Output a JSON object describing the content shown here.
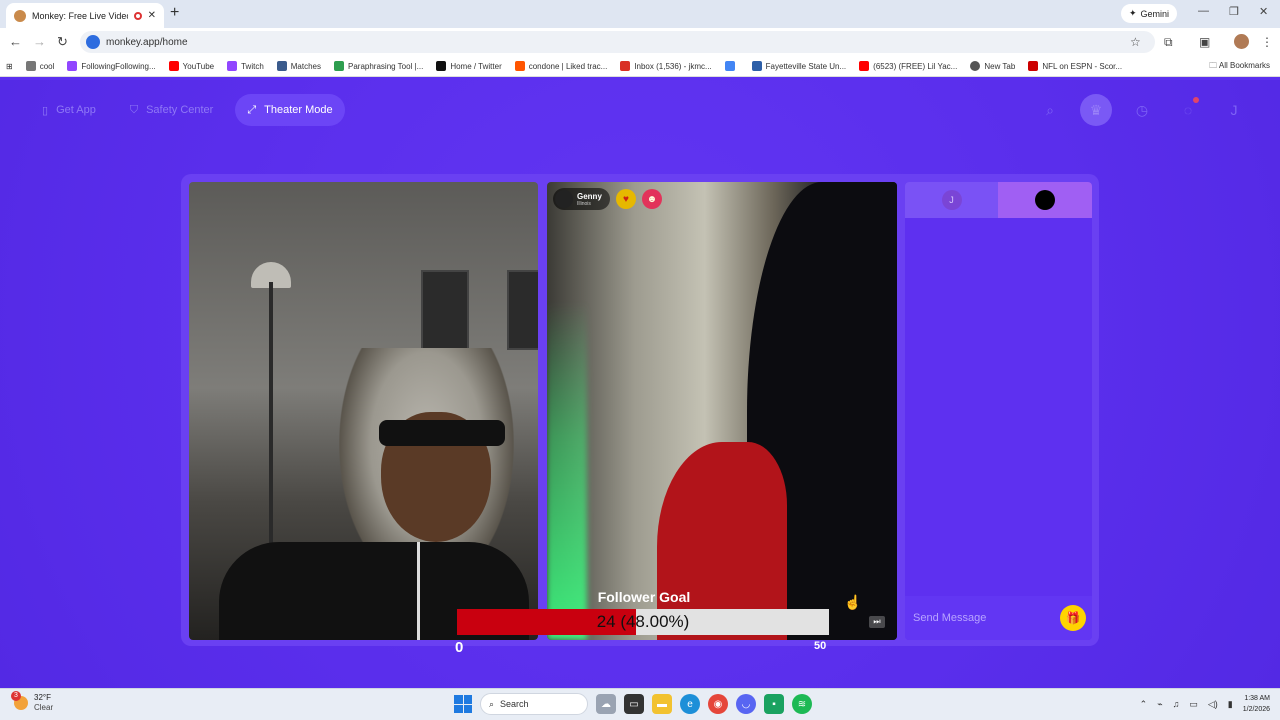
{
  "browser": {
    "tab_title": "Monkey: Free Live Video C",
    "new_tab": "+",
    "close": "✕",
    "gemini_label": "Gemini",
    "url": "monkey.app/home",
    "bookmarks": [
      {
        "label": "cool",
        "color": "#777777"
      },
      {
        "label": "FollowingFollowing...",
        "color": "#9146ff"
      },
      {
        "label": "YouTube",
        "color": "#ff0000"
      },
      {
        "label": "Twitch",
        "color": "#9146ff"
      },
      {
        "label": "Matches",
        "color": "#3b5b8c"
      },
      {
        "label": "Paraphrasing Tool |...",
        "color": "#2e9e4f"
      },
      {
        "label": "Home / Twitter",
        "color": "#111111"
      },
      {
        "label": "condone | Liked trac...",
        "color": "#ff5500"
      },
      {
        "label": "Inbox (1,536) - jkmc...",
        "color": "#d93025"
      },
      {
        "label": "",
        "color": "#4285f4"
      },
      {
        "label": "Fayetteville State Un...",
        "color": "#2d5fa8"
      },
      {
        "label": "(6523) (FREE) Lil Yac...",
        "color": "#ff0000"
      },
      {
        "label": "New Tab",
        "color": "#555555"
      },
      {
        "label": "NFL on ESPN - Scor...",
        "color": "#cc0000"
      }
    ],
    "all_bookmarks": "All Bookmarks"
  },
  "nav": {
    "get_app": "Get App",
    "safety_center": "Safety Center",
    "theater_mode": "Theater Mode"
  },
  "right_nav_icons": [
    "search-icon",
    "crown-icon",
    "history-icon",
    "chat-icon",
    "profile-icon"
  ],
  "profile_initial": "J",
  "remote_user": {
    "name": "Genny",
    "location": "Illinois"
  },
  "chat": {
    "self_initial": "J",
    "placeholder": "Send Message"
  },
  "follower_goal": {
    "title": "Follower Goal",
    "current": 24,
    "text": "24 (48.00%)",
    "progress_percent": 48,
    "min_label": "0",
    "max_label": "50",
    "fill_color": "#c9000f"
  },
  "taskbar": {
    "weather_badge": "3",
    "temperature": "32°F",
    "condition": "Clear",
    "search_label": "Search",
    "time": "1:38 AM",
    "date": "1/2/2026"
  },
  "colors": {
    "page_bg": "#5b2ff0",
    "accent": "#6c45f6",
    "gift": "#ffd400"
  }
}
